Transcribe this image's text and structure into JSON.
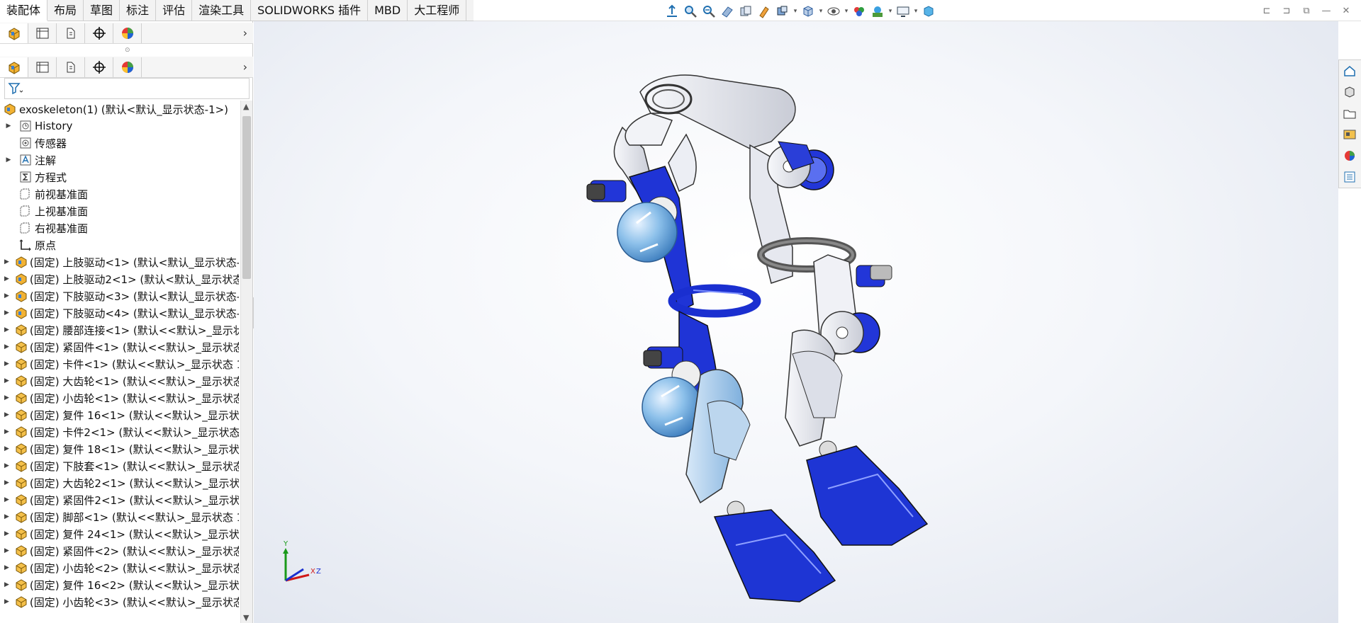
{
  "command_tabs": [
    "装配体",
    "布局",
    "草图",
    "标注",
    "评估",
    "渲染工具",
    "SOLIDWORKS 插件",
    "MBD",
    "大工程师"
  ],
  "active_tab": "装配体",
  "heads_up_icons": [
    "zoom-to-fit-icon",
    "zoom-area-icon",
    "previous-view-icon",
    "section-view-icon",
    "dynamic-annotation-icon",
    "view-setting-icon",
    "display-style-icon",
    "hide-show-icon",
    "edit-appearance-icon",
    "apply-scene-icon",
    "view-settings-icon",
    "view-cube-icon"
  ],
  "window_controls": [
    "tile-left-icon",
    "tile-right-icon",
    "restore-icon",
    "minimize-icon",
    "close-icon"
  ],
  "manager_tabs": [
    "featuremanager-icon",
    "propertymanager-icon",
    "configurationmanager-icon",
    "dimxpert-icon",
    "displaymanager-icon"
  ],
  "tree": {
    "root": "exoskeleton(1)  (默认<默认_显示状态-1>)",
    "items": [
      {
        "label": "History",
        "icon": "history-icon",
        "expandable": true
      },
      {
        "label": "传感器",
        "icon": "sensor-icon",
        "expandable": false
      },
      {
        "label": "注解",
        "icon": "annotation-icon",
        "expandable": true
      },
      {
        "label": "方程式",
        "icon": "equation-icon",
        "expandable": false
      },
      {
        "label": "前视基准面",
        "icon": "plane-icon",
        "expandable": false
      },
      {
        "label": "上视基准面",
        "icon": "plane-icon",
        "expandable": false
      },
      {
        "label": "右视基准面",
        "icon": "plane-icon",
        "expandable": false
      },
      {
        "label": "原点",
        "icon": "origin-icon",
        "expandable": false
      },
      {
        "label": "(固定) 上肢驱动<1> (默认<默认_显示状态-",
        "icon": "subassembly-icon",
        "expandable": true
      },
      {
        "label": "(固定) 上肢驱动2<1> (默认<默认_显示状态",
        "icon": "subassembly-icon",
        "expandable": true
      },
      {
        "label": "(固定) 下肢驱动<3> (默认<默认_显示状态-",
        "icon": "subassembly-icon",
        "expandable": true
      },
      {
        "label": "(固定) 下肢驱动<4> (默认<默认_显示状态-",
        "icon": "subassembly-icon",
        "expandable": true
      },
      {
        "label": "(固定) 腰部连接<1> (默认<<默认>_显示状",
        "icon": "part-icon",
        "expandable": true
      },
      {
        "label": "(固定) 紧固件<1> (默认<<默认>_显示状态",
        "icon": "part-icon",
        "expandable": true
      },
      {
        "label": "(固定) 卡件<1> (默认<<默认>_显示状态 1",
        "icon": "part-icon",
        "expandable": true
      },
      {
        "label": "(固定) 大齿轮<1> (默认<<默认>_显示状态",
        "icon": "part-icon",
        "expandable": true
      },
      {
        "label": "(固定) 小齿轮<1> (默认<<默认>_显示状态",
        "icon": "part-icon",
        "expandable": true
      },
      {
        "label": "(固定) 复件 16<1> (默认<<默认>_显示状",
        "icon": "part-icon",
        "expandable": true
      },
      {
        "label": "(固定) 卡件2<1> (默认<<默认>_显示状态",
        "icon": "part-icon",
        "expandable": true
      },
      {
        "label": "(固定) 复件 18<1> (默认<<默认>_显示状",
        "icon": "part-icon",
        "expandable": true
      },
      {
        "label": "(固定) 下肢套<1> (默认<<默认>_显示状态",
        "icon": "part-icon",
        "expandable": true
      },
      {
        "label": "(固定) 大齿轮2<1> (默认<<默认>_显示状",
        "icon": "part-icon",
        "expandable": true
      },
      {
        "label": "(固定) 紧固件2<1> (默认<<默认>_显示状",
        "icon": "part-icon",
        "expandable": true
      },
      {
        "label": "(固定) 脚部<1> (默认<<默认>_显示状态 1",
        "icon": "part-icon",
        "expandable": true
      },
      {
        "label": "(固定) 复件 24<1> (默认<<默认>_显示状",
        "icon": "part-icon",
        "expandable": true
      },
      {
        "label": "(固定) 紧固件<2> (默认<<默认>_显示状态",
        "icon": "part-icon",
        "expandable": true
      },
      {
        "label": "(固定) 小齿轮<2> (默认<<默认>_显示状态",
        "icon": "part-icon",
        "expandable": true
      },
      {
        "label": "(固定) 复件 16<2> (默认<<默认>_显示状",
        "icon": "part-icon",
        "expandable": true
      },
      {
        "label": "(固定) 小齿轮<3> (默认<<默认>_显示状态",
        "icon": "part-icon",
        "expandable": true
      }
    ]
  },
  "triad": {
    "x": "X",
    "y": "Y",
    "z": "Z"
  },
  "task_pane_icons": [
    "home-icon",
    "design-library-icon",
    "file-explorer-icon",
    "view-palette-icon",
    "appearances-icon",
    "custom-properties-icon"
  ],
  "colors": {
    "accent_blue": "#1a2fd6",
    "light_blue": "#7fb6e6",
    "grey_part": "#d8dbe3"
  }
}
